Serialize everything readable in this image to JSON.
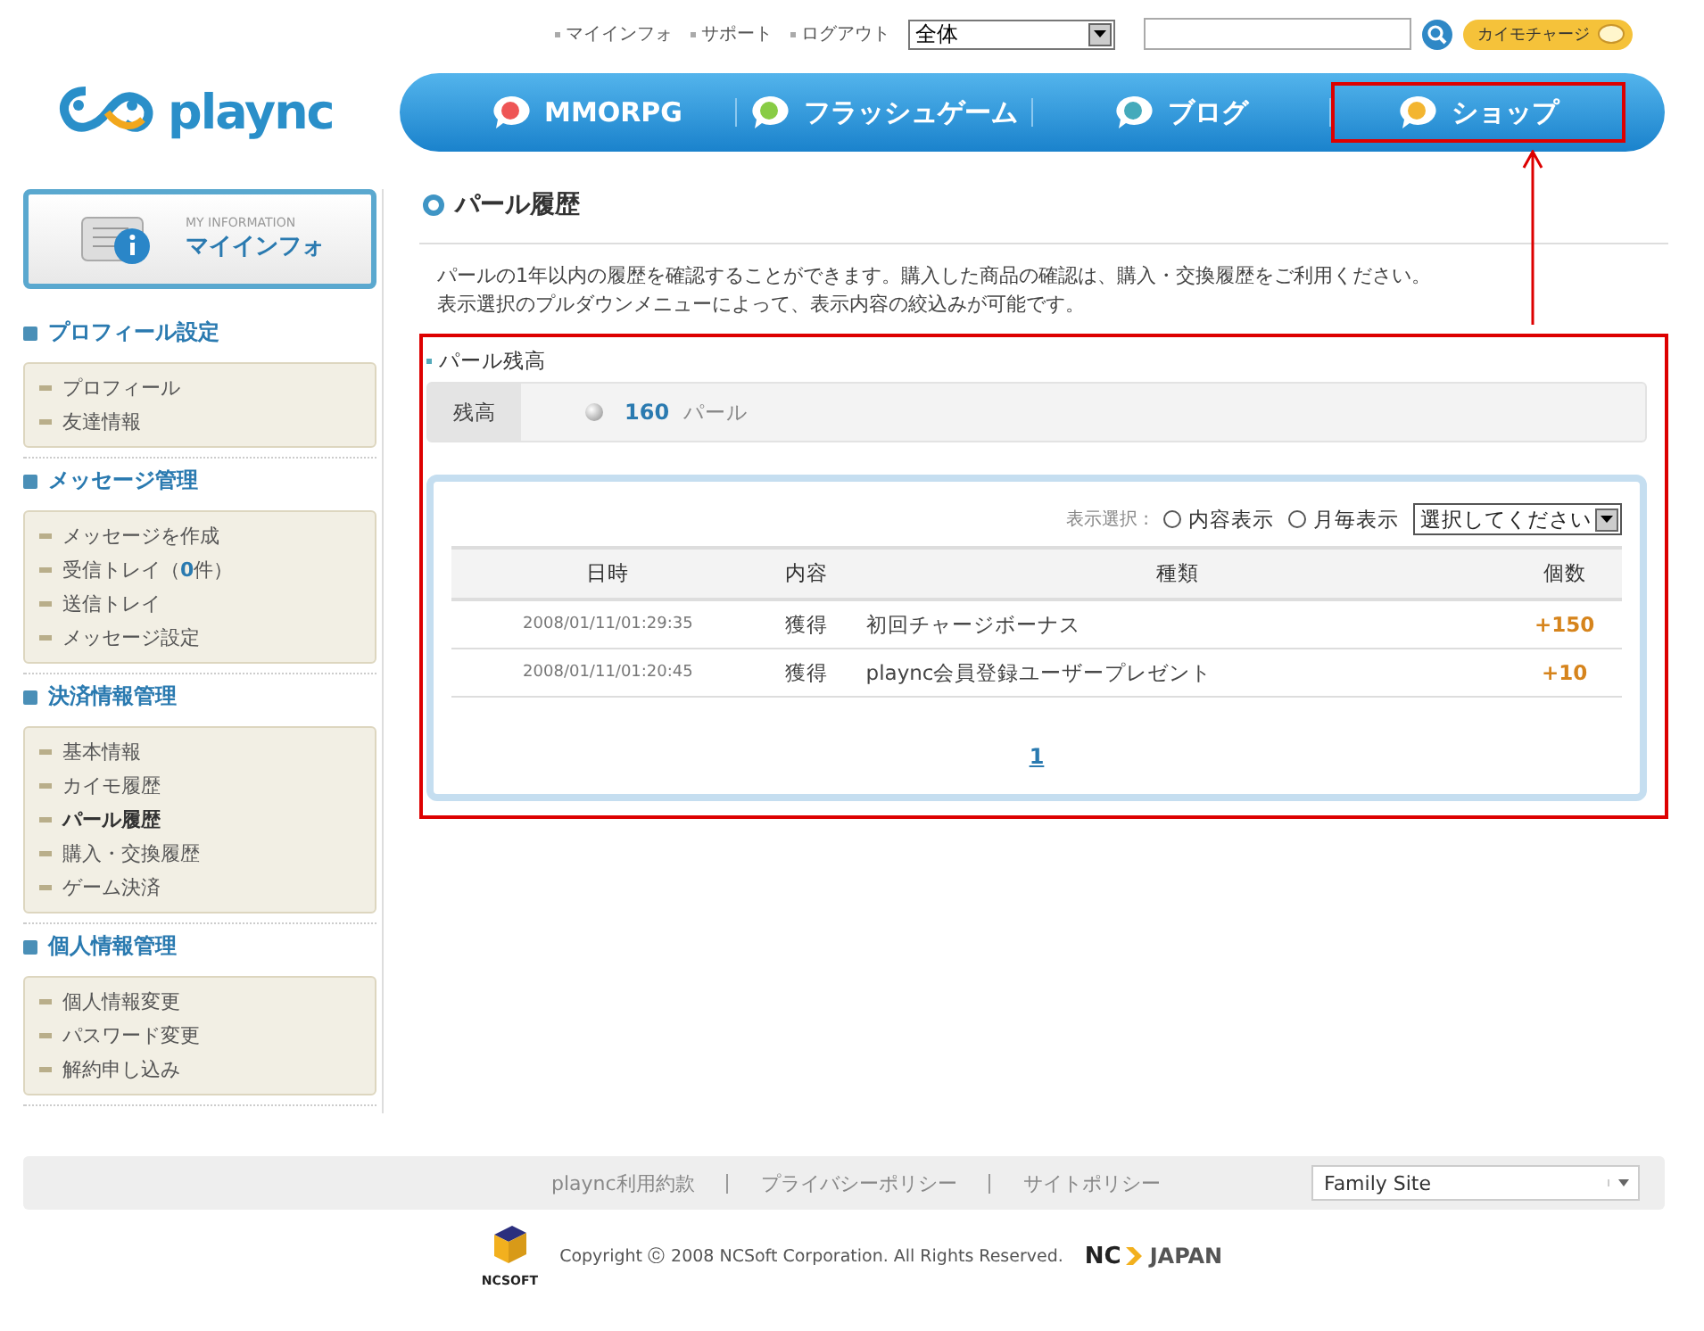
{
  "top_links": [
    "マイインフォ",
    "サポート",
    "ログアウト"
  ],
  "search": {
    "scope": "全体",
    "button": "カイモチャージ"
  },
  "logo": "plaync",
  "nav": [
    {
      "label": "MMORPG",
      "highlighted": false
    },
    {
      "label": "フラッシュゲーム",
      "highlighted": false
    },
    {
      "label": "ブログ",
      "highlighted": false
    },
    {
      "label": "ショップ",
      "highlighted": true
    }
  ],
  "myinfo": {
    "caption": "MY INFORMATION",
    "title": "マイインフォ"
  },
  "sidebar": [
    {
      "title": "プロフィール設定",
      "items": [
        {
          "label": "プロフィール",
          "selected": false
        },
        {
          "label": "友達情報",
          "selected": false
        }
      ]
    },
    {
      "title": "メッセージ管理",
      "items": [
        {
          "label": "メッセージを作成",
          "selected": false
        },
        {
          "label": "受信トレイ（**0**件）",
          "selected": false
        },
        {
          "label": "送信トレイ",
          "selected": false
        },
        {
          "label": "メッセージ設定",
          "selected": false
        }
      ]
    },
    {
      "title": "決済情報管理",
      "items": [
        {
          "label": "基本情報",
          "selected": false
        },
        {
          "label": "カイモ履歴",
          "selected": false
        },
        {
          "label": "パール履歴",
          "selected": true
        },
        {
          "label": "購入・交換履歴",
          "selected": false
        },
        {
          "label": "ゲーム決済",
          "selected": false
        }
      ]
    },
    {
      "title": "個人情報管理",
      "items": [
        {
          "label": "個人情報変更",
          "selected": false
        },
        {
          "label": "パスワード変更",
          "selected": false
        },
        {
          "label": "解約申し込み",
          "selected": false
        }
      ]
    }
  ],
  "page": {
    "title": "パール履歴",
    "description": [
      "パールの1年以内の履歴を確認することができます。購入した商品の確認は、購入・交換履歴をご利用ください。",
      "表示選択のプルダウンメニューによって、表示内容の絞込みが可能です。"
    ]
  },
  "balance": {
    "highlighted": true,
    "title": "パール残高",
    "label": "残高",
    "amount": "160",
    "unit": "パール"
  },
  "filter": {
    "label": "表示選択 :",
    "options": [
      {
        "label": "内容表示",
        "selected": false
      },
      {
        "label": "月毎表示",
        "selected": false
      }
    ],
    "select": "選択してください"
  },
  "table": {
    "columns": [
      "日時",
      "内容",
      "種類",
      "個数"
    ],
    "rows": [
      [
        "2008/01/11/01:29:35",
        "獲得",
        "初回チャージボーナス",
        "+150"
      ],
      [
        "2008/01/11/01:20:45",
        "獲得",
        "plaync会員登録ユーザープレゼント",
        "+10"
      ]
    ]
  },
  "pages": [
    "1"
  ],
  "footer": {
    "links": [
      "plaync利用約款",
      "プライバシーポリシー",
      "サイトポリシー"
    ],
    "family_site": "Family Site",
    "ncsoft": "NCSOFT",
    "copyright": "Copyright ⓒ 2008 NCSoft Corporation. All Rights Reserved.",
    "nc": "NC",
    "japan": "JAPAN"
  }
}
